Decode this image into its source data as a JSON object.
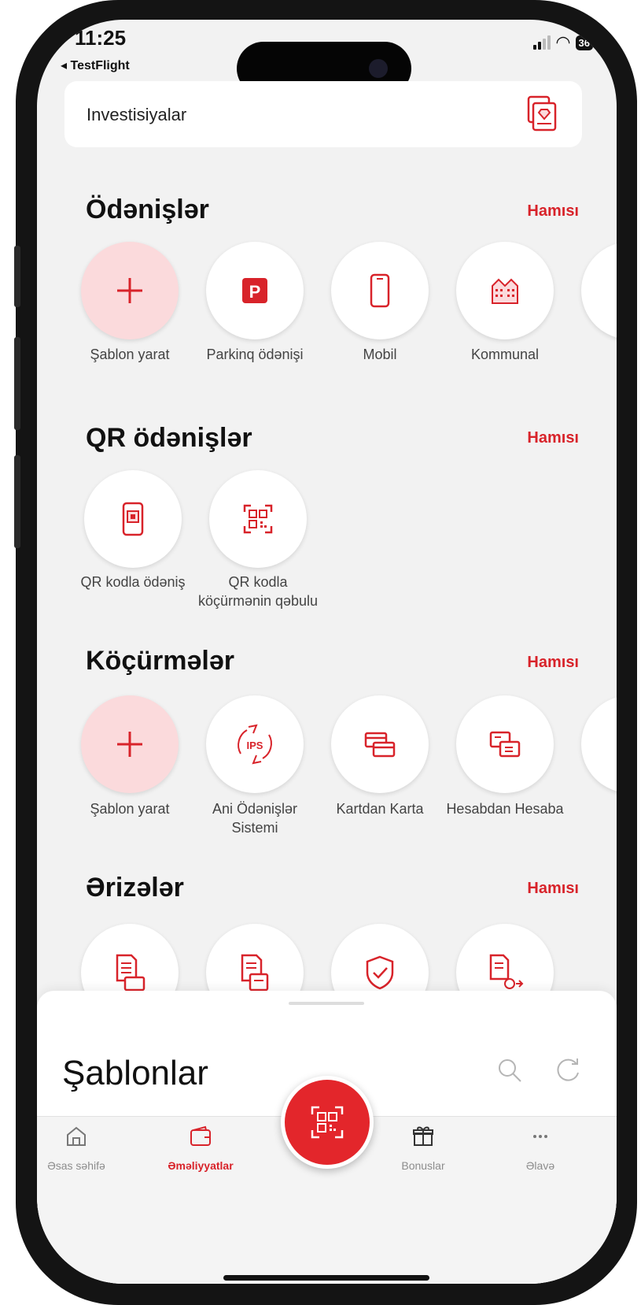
{
  "status_bar": {
    "time": "11:25",
    "back_app": "◂ TestFlight",
    "battery": "36"
  },
  "invest_card": {
    "label": "Investisiyalar",
    "icon": "document-diamond-icon"
  },
  "payments": {
    "title": "Ödənişlər",
    "all_link": "Hamısı",
    "items": [
      {
        "label": "Şablon yarat",
        "icon": "plus-icon"
      },
      {
        "label": "Parkinq ödənişi",
        "icon": "parking-icon"
      },
      {
        "label": "Mobil",
        "icon": "mobile-phone-icon"
      },
      {
        "label": "Kommunal",
        "icon": "buildings-icon"
      }
    ]
  },
  "qr_payments": {
    "title": "QR ödənişlər",
    "all_link": "Hamısı",
    "items": [
      {
        "label": "QR kodla ödəniş",
        "icon": "phone-qr-icon"
      },
      {
        "label": "QR kodla köçürmənin qəbulu",
        "icon": "qr-scan-icon"
      }
    ]
  },
  "transfers": {
    "title": "Köçürmələr",
    "all_link": "Hamısı",
    "items": [
      {
        "label": "Şablon yarat",
        "icon": "plus-icon"
      },
      {
        "label": "Ani Ödənişlər Sistemi",
        "icon": "ips-icon",
        "badge": "IPS"
      },
      {
        "label": "Kartdan Karta",
        "icon": "cards-icon"
      },
      {
        "label": "Hesabdan Hesaba",
        "icon": "accounts-icon"
      }
    ]
  },
  "applications": {
    "title": "Ərizələr",
    "all_link": "Hamısı",
    "items": [
      {
        "icon": "document-card-icon"
      },
      {
        "icon": "document-stack-icon"
      },
      {
        "icon": "shield-check-icon"
      },
      {
        "icon": "document-money-icon"
      }
    ]
  },
  "templates_sheet": {
    "title": "Şablonlar",
    "search_icon": "search-icon",
    "refresh_icon": "refresh-icon"
  },
  "tab_bar": {
    "tabs": [
      {
        "label": "Əsas səhifə",
        "icon": "home-icon",
        "active": false
      },
      {
        "label": "Əməliyyatlar",
        "icon": "wallet-icon",
        "active": true
      },
      {
        "label": "Bonuslar",
        "icon": "gift-icon",
        "active": false
      },
      {
        "label": "Əlavə",
        "icon": "more-icon",
        "active": false
      }
    ],
    "center_button_icon": "qr-scan-icon"
  },
  "colors": {
    "accent": "#d8232a",
    "background": "#f2f2f2",
    "tile_pink": "#fbdadc"
  }
}
